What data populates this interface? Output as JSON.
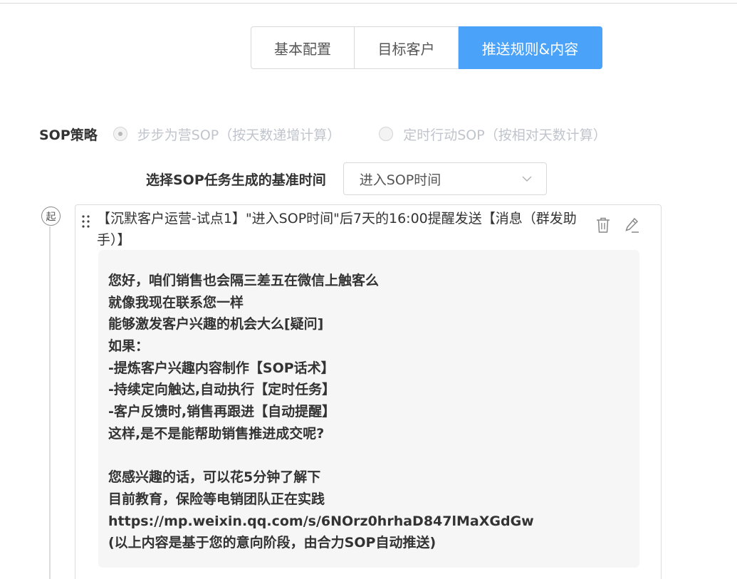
{
  "tabs": [
    {
      "label": "基本配置",
      "active": false
    },
    {
      "label": "目标客户",
      "active": false
    },
    {
      "label": "推送规则&内容",
      "active": true
    }
  ],
  "strategy": {
    "label": "SOP策略",
    "options": [
      {
        "label": "步步为营SOP（按天数递增计算）",
        "checked": true
      },
      {
        "label": "定时行动SOP（按相对天数计算）",
        "checked": false
      }
    ]
  },
  "base_time": {
    "label": "选择SOP任务生成的基准时间",
    "selected": "进入SOP时间"
  },
  "timeline": {
    "start_label": "起"
  },
  "task_card": {
    "title": "【沉默客户运营-试点1】\"进入SOP时间\"后7天的16:00提醒发送【消息（群发助手）】",
    "message_lines": [
      "您好，咱们销售也会隔三差五在微信上触客么",
      "就像我现在联系您一样",
      "能够激发客户兴趣的机会大么[疑问]",
      "如果：",
      "-提炼客户兴趣内容制作【SOP话术】",
      "-持续定向触达,自动执行【定时任务】",
      "-客户反馈时,销售再跟进【自动提醒】",
      "这样,是不是能帮助销售推进成交呢?",
      "",
      "您感兴趣的话，可以花5分钟了解下",
      "目前教育，保险等电销团队正在实践",
      "https://mp.weixin.qq.com/s/6NOrz0hrhaD847lMaXGdGw",
      "(以上内容是基于您的意向阶段，由合力SOP自动推送)"
    ]
  },
  "colors": {
    "accent": "#4aa3f8",
    "disabled_text": "#c0c4cc",
    "message_bg": "#f6f6f6"
  },
  "icons": {
    "drag": "drag-handle-icon",
    "delete": "trash-icon",
    "edit": "pencil-icon",
    "select": "chevron-down-icon"
  }
}
